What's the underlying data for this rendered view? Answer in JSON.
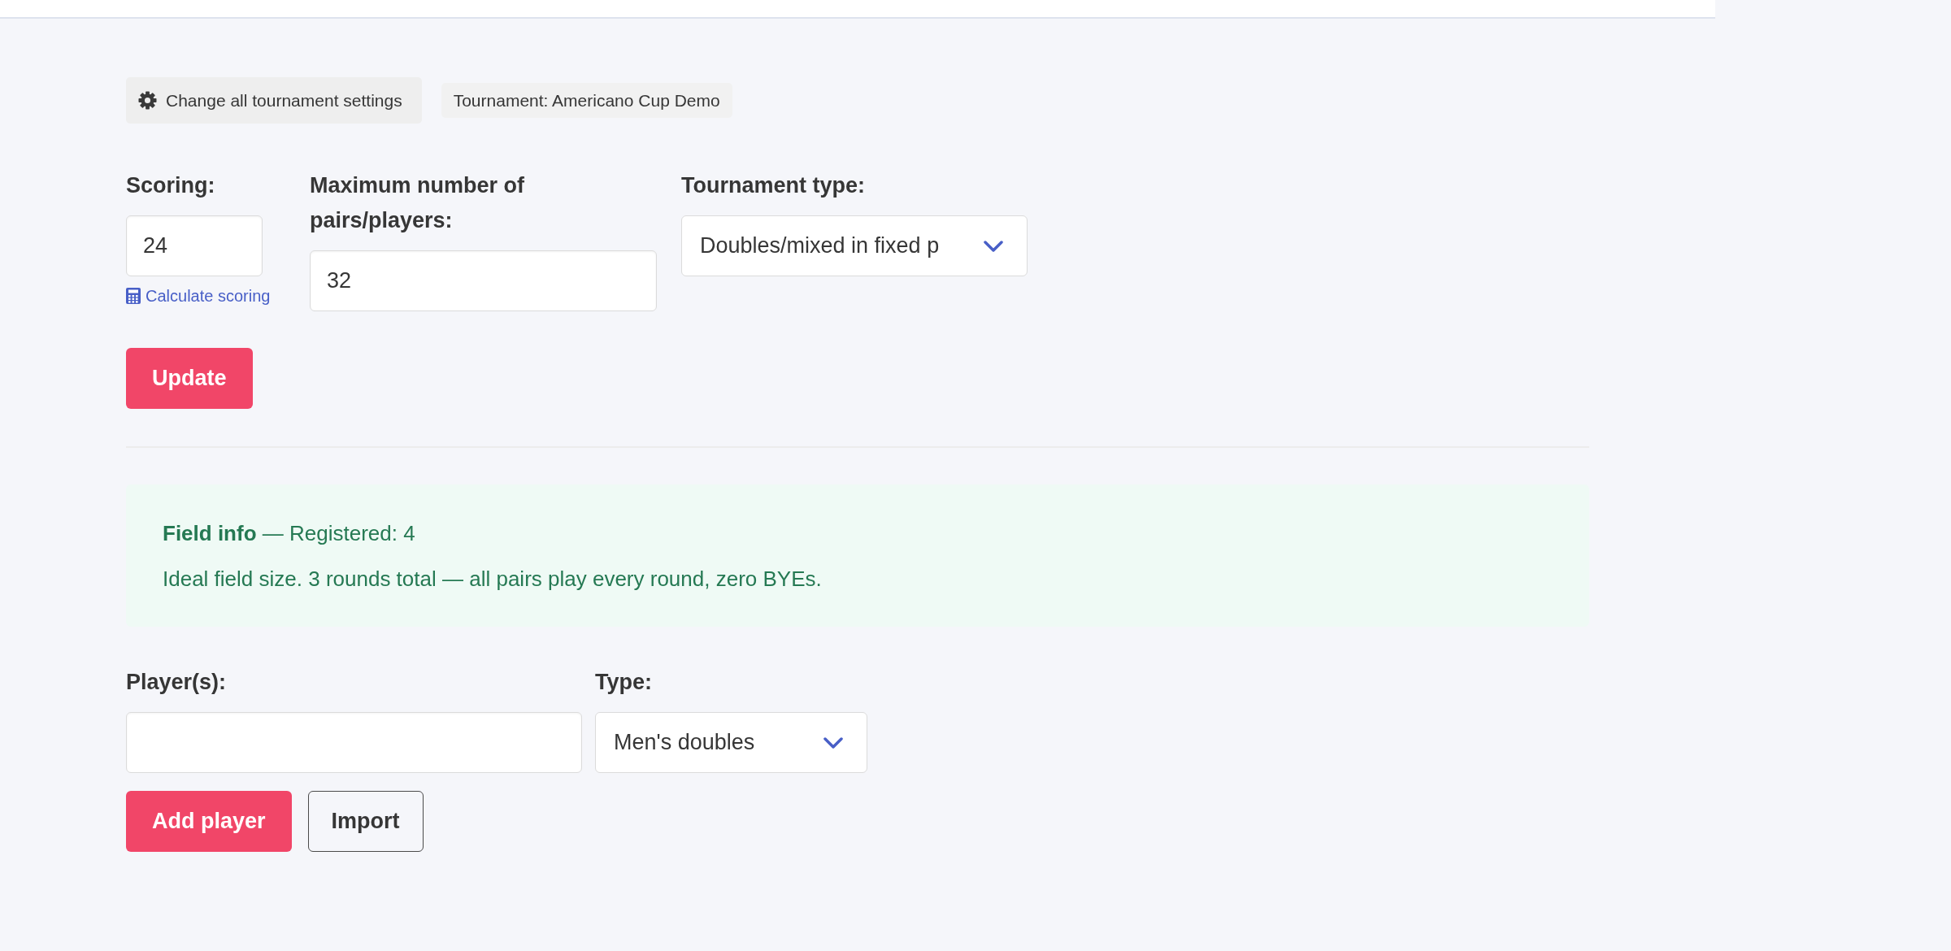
{
  "toolbar": {
    "settings_button": "Change all tournament settings",
    "tournament_tag": "Tournament: Americano Cup Demo"
  },
  "settings_form": {
    "fields": [
      {
        "kind": "input",
        "label": "Scoring:",
        "value": "24",
        "link": "Calculate scoring"
      },
      {
        "kind": "input",
        "label": "Maximum number of pairs/players:",
        "value": "32"
      },
      {
        "kind": "select",
        "label": "Tournament type:",
        "value": "Doubles/mixed in fixed p"
      }
    ],
    "submit_button": "Update"
  },
  "field_info": {
    "heading": "**Field info** — Registered: 4",
    "message": "Ideal field size. 3 rounds total — all pairs play every round, zero BYEs."
  },
  "player_form": {
    "fields": [
      {
        "kind": "input",
        "label": "Player(s):"
      },
      {
        "kind": "select",
        "label": "Type:",
        "value": "Men's doubles"
      }
    ],
    "buttons": [
      {
        "kind": "primary",
        "label": "Add player"
      },
      {
        "kind": "outline",
        "label": "Import"
      }
    ]
  }
}
